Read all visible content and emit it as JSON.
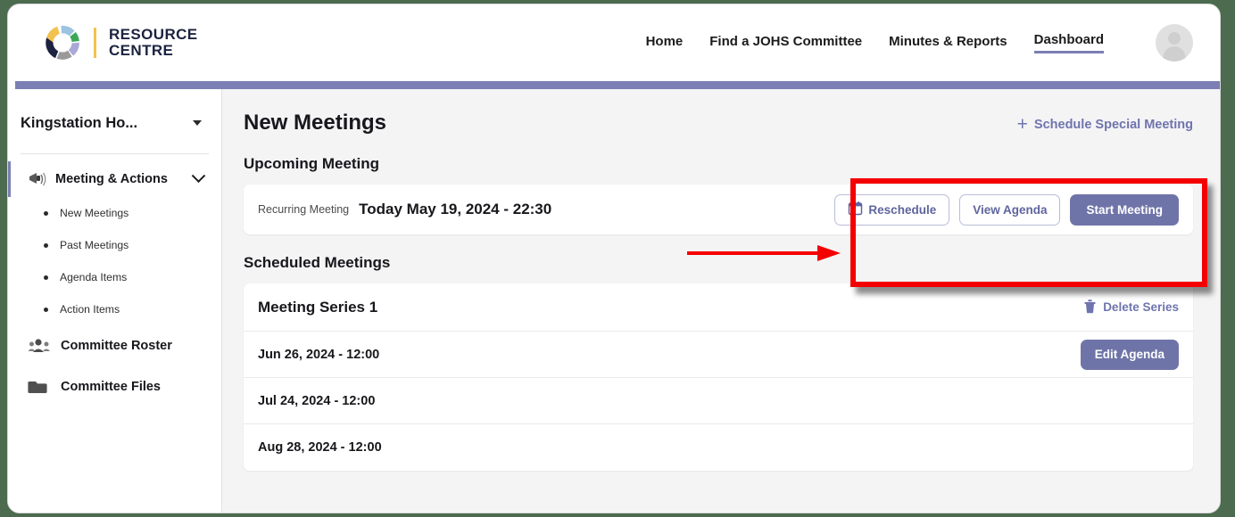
{
  "brand": {
    "mark": "ohs-logo-ring",
    "line1": "RESOURCE",
    "line2": "CENTRE"
  },
  "nav": {
    "items": [
      {
        "label": "Home",
        "active": false
      },
      {
        "label": "Find a JOHS Committee",
        "active": false
      },
      {
        "label": "Minutes & Reports",
        "active": false
      },
      {
        "label": "Dashboard",
        "active": true
      }
    ],
    "avatar_icon": "user-avatar-icon"
  },
  "sidebar": {
    "org_name": "Kingstation Ho...",
    "org_caret_icon": "caret-down-icon",
    "group": {
      "label": "Meeting & Actions",
      "icon": "megaphone-icon",
      "chevron_icon": "chevron-down-icon",
      "sub_items": [
        {
          "label": "New Meetings"
        },
        {
          "label": "Past Meetings"
        },
        {
          "label": "Agenda Items"
        },
        {
          "label": "Action Items"
        }
      ]
    },
    "rows": [
      {
        "label": "Committee Roster",
        "icon": "people-group-icon"
      },
      {
        "label": "Committee Files",
        "icon": "folder-icon"
      }
    ]
  },
  "main": {
    "page_title": "New Meetings",
    "schedule_special": {
      "label": "Schedule Special Meeting",
      "plus": "+",
      "icon": "plus-icon"
    },
    "upcoming": {
      "section_title": "Upcoming Meeting",
      "type_label": "Recurring Meeting",
      "datetime": "Today May 19, 2024 - 22:30",
      "actions": [
        {
          "label": "Reschedule",
          "style": "outline",
          "icon": "calendar-icon"
        },
        {
          "label": "View Agenda",
          "style": "outline",
          "icon": ""
        },
        {
          "label": "Start Meeting",
          "style": "filled",
          "icon": ""
        }
      ]
    },
    "scheduled": {
      "section_title": "Scheduled Meetings",
      "series_title": "Meeting Series 1",
      "delete_label": "Delete Series",
      "delete_icon": "trash-icon",
      "rows": [
        {
          "date": "Jun 26, 2024 - 12:00",
          "action": "Edit Agenda"
        },
        {
          "date": "Jul 24, 2024 - 12:00",
          "action": ""
        },
        {
          "date": "Aug 28, 2024 - 12:00",
          "action": ""
        }
      ]
    }
  },
  "annotations": {
    "highlight_box_color": "#f50000",
    "arrow_color": "#f50000",
    "arrow_points_to": "meeting-action-buttons"
  },
  "colors": {
    "accent_purple": "#7b7fb5",
    "button_purple": "#6f74a8",
    "link_purple": "#6f74ad",
    "page_background": "#f4f4f5",
    "card_background": "#ffffff",
    "text_dark": "#17171c",
    "outside_background": "#4c6b4f"
  }
}
